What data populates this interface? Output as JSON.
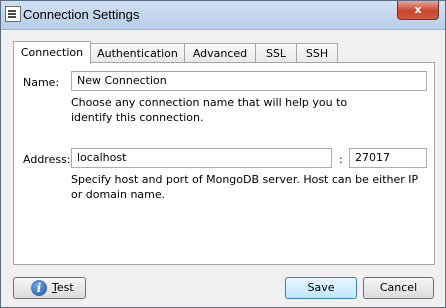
{
  "window": {
    "title": "Connection Settings",
    "close_glyph": "x"
  },
  "tabs": [
    {
      "label": "Connection",
      "active": true
    },
    {
      "label": "Authentication",
      "active": false
    },
    {
      "label": "Advanced",
      "active": false
    },
    {
      "label": "SSL",
      "active": false
    },
    {
      "label": "SSH",
      "active": false
    }
  ],
  "form": {
    "name_label": "Name:",
    "name_value": "New Connection",
    "name_hint": "Choose any connection name that will help you to identify this connection.",
    "address_label": "Address:",
    "host_value": "localhost",
    "port_separator": ":",
    "port_value": "27017",
    "address_hint": "Specify host and port of MongoDB server. Host can be either IP or domain name."
  },
  "buttons": {
    "test_label_underlined": "T",
    "test_label_rest": "est",
    "save_label": "Save",
    "cancel_label": "Cancel"
  },
  "icons": {
    "info": "info-icon"
  },
  "colors": {
    "close_button": "#c8452f",
    "default_button": "#bee6fd"
  }
}
